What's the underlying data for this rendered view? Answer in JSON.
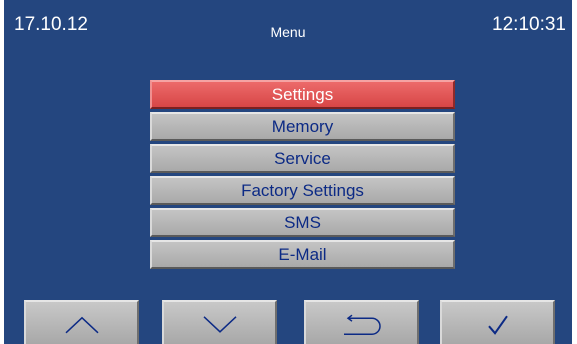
{
  "header": {
    "date": "17.10.12",
    "title": "Menu",
    "time": "12:10:31"
  },
  "menu": {
    "items": [
      {
        "label": "Settings",
        "selected": true
      },
      {
        "label": "Memory",
        "selected": false
      },
      {
        "label": "Service",
        "selected": false
      },
      {
        "label": "Factory Settings",
        "selected": false
      },
      {
        "label": "SMS",
        "selected": false
      },
      {
        "label": "E-Mail",
        "selected": false
      }
    ]
  },
  "nav_buttons": {
    "up_icon": "chevron-up-icon",
    "down_icon": "chevron-down-icon",
    "back_icon": "return-arrow-icon",
    "ok_icon": "checkmark-icon"
  },
  "colors": {
    "background": "#24467f",
    "selected_item": "#e05252",
    "item": "#b4b4b4",
    "item_text": "#0c2a85"
  }
}
